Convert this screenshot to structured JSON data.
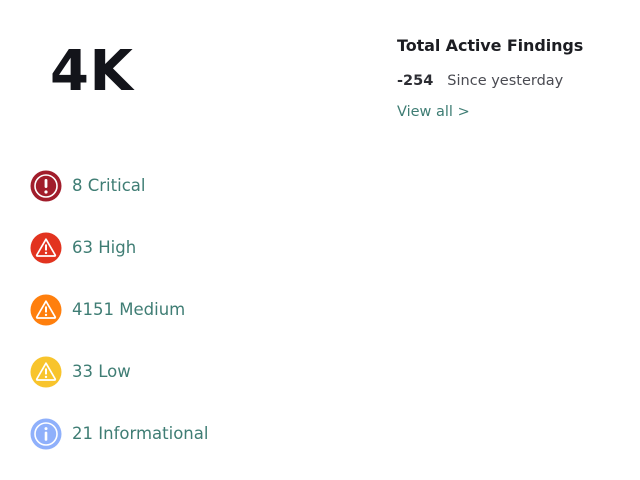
{
  "summary": {
    "big_count": "4K",
    "title": "Total Active Findings",
    "delta_value": "-254",
    "delta_label": "Since yesterday",
    "view_all": "View all >"
  },
  "severities": [
    {
      "count": "8",
      "label": "Critical",
      "icon": "critical-exclamation-icon",
      "color": "#a11d2b"
    },
    {
      "count": "63",
      "label": "High",
      "icon": "high-warning-icon",
      "color": "#e2331f"
    },
    {
      "count": "4151",
      "label": "Medium",
      "icon": "medium-warning-icon",
      "color": "#ff7f0d"
    },
    {
      "count": "33",
      "label": "Low",
      "icon": "low-warning-icon",
      "color": "#f8c42c"
    },
    {
      "count": "21",
      "label": "Informational",
      "icon": "info-icon",
      "color": "#8fb0fb"
    }
  ]
}
